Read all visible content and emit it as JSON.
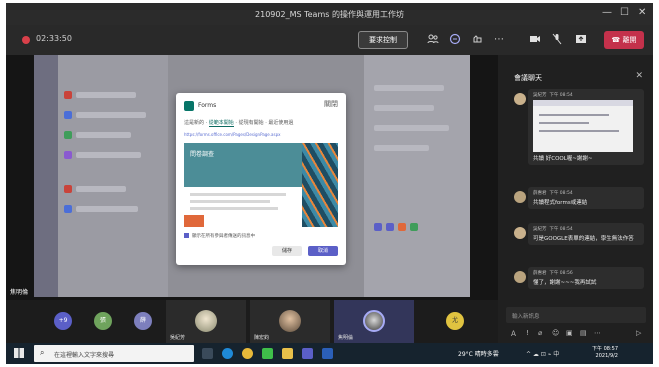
{
  "window": {
    "title": "210902_MS Teams 的操作與運用工作坊",
    "minimize": "—",
    "maximize": "☐",
    "close": "✕"
  },
  "toolbar": {
    "timer": "02:33:50",
    "request_control": "要求控制",
    "leave_label": "離開",
    "icons": [
      "participants-icon",
      "chat-icon",
      "reactions-icon",
      "more-icon",
      "camera-icon",
      "mic-off-icon",
      "share-icon"
    ]
  },
  "stage": {
    "presenter": "焦明倫",
    "dialog": {
      "title": "Forms",
      "tabs": [
        "這是新的",
        "從範本開始",
        "從現有開始",
        "最近使用過"
      ],
      "active_tab": 1,
      "url_line": "https://forms.office.com/Pages/DesignPage.aspx",
      "banner": "問卷調查",
      "option": "顯示在所有參與者傳送的訊息中",
      "save": "儲存",
      "cancel": "取消",
      "closing": "關閉"
    }
  },
  "participants": {
    "avatars": [
      {
        "label": "+9",
        "color": "#5b5fc7"
      },
      {
        "label": "張",
        "color": "#6fa35d"
      },
      {
        "label": "薛",
        "color": "#7d7fbd"
      }
    ],
    "tiles": [
      {
        "name": "吳紀芳"
      },
      {
        "name": "陳宏鈞"
      },
      {
        "name": "焦明倫"
      }
    ],
    "last_avatar": {
      "label": "尤",
      "color": "#e0c340"
    }
  },
  "chat": {
    "title": "會議聊天",
    "messages": [
      {
        "sender": "吳紀芳",
        "time": "下午 08:54",
        "text": "共讀 好COOL喔~謝謝~",
        "has_image": true
      },
      {
        "sender": "薛惠君",
        "time": "下午 08:54",
        "text": "共讀程式forms或連結",
        "has_image": false
      },
      {
        "sender": "吳紀芳",
        "time": "下午 08:54",
        "text": "可是GOOGLE表單的連結，學生無法作答",
        "has_image": false
      },
      {
        "sender": "薛惠君",
        "time": "下午 08:56",
        "text": "懂了，謝謝~~~我再試試",
        "has_image": false
      }
    ],
    "input_placeholder": "輸入新訊息",
    "compose_icons": [
      "format-icon",
      "exclamation-icon",
      "attach-icon",
      "emoji-icon",
      "gif-icon",
      "sticker-icon",
      "more-icon",
      "send-icon"
    ]
  },
  "taskbar": {
    "search_placeholder": "在這裡輸入文字來搜尋",
    "weather": "29°C 晴時多雲",
    "tray": "^ ☁ ⊡ ⌁ 中",
    "time": "下午 08:57",
    "date": "2021/9/2"
  }
}
